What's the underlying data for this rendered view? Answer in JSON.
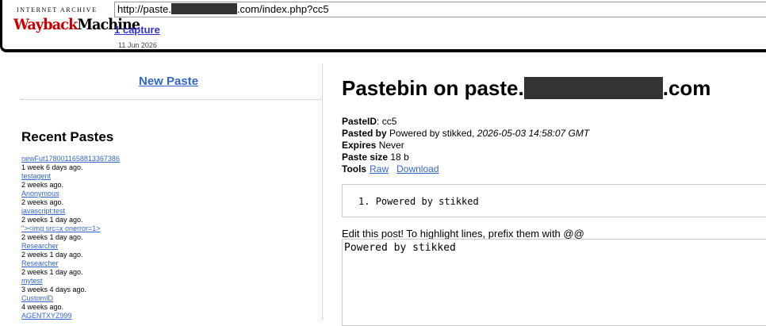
{
  "wayback": {
    "logo_top": "INTERNET ARCHIVE",
    "logo_main_red": "Wayback",
    "logo_main_black": "Machine",
    "url_prefix": "http://paste.",
    "url_suffix": ".com/index.php?cc5",
    "capture_link": "1 capture",
    "capture_date": "11 Jun 2026"
  },
  "left": {
    "new_paste": "New Paste",
    "recent_title": "Recent Pastes",
    "recent": [
      {
        "title": "newFut1780011658813367386",
        "ago": "1 week 6 days ago."
      },
      {
        "title": "testagent",
        "ago": "2 weeks ago."
      },
      {
        "title": "Anonymous",
        "ago": "2 weeks ago."
      },
      {
        "title": "javascript:test",
        "ago": "2 weeks 1 day ago."
      },
      {
        "title": "\"><img src=x onerror=1>",
        "ago": "2 weeks 1 day ago."
      },
      {
        "title": "Researcher",
        "ago": "2 weeks 1 day ago."
      },
      {
        "title": "Researcher",
        "ago": "2 weeks 1 day ago."
      },
      {
        "title": "mytest",
        "ago": "3 weeks 4 days ago."
      },
      {
        "title": "CustomID",
        "ago": "4 weeks ago."
      },
      {
        "title": "AGENTXYZ999",
        "ago": ""
      }
    ]
  },
  "paste": {
    "title_prefix": "Pastebin on paste.",
    "title_suffix": ".com",
    "pasteid_label": "PasteID",
    "pasteid_value": ": cc5",
    "pastedby_label": "Pasted by",
    "pastedby_value": " Powered by stikked, ",
    "date": "2026-05-03 14:58:07 GMT",
    "expires_label": "Expires",
    "expires_value": " Never",
    "size_label": "Paste size",
    "size_value": " 18 b",
    "tools_label": "Tools",
    "raw_link": "Raw",
    "download_link": "Download",
    "code_line_num": "1.",
    "code_line_text": "Powered by stikked",
    "edit_label": "Edit this post! To highlight lines, prefix them with @@",
    "editor_value": "Powered by stikked"
  }
}
